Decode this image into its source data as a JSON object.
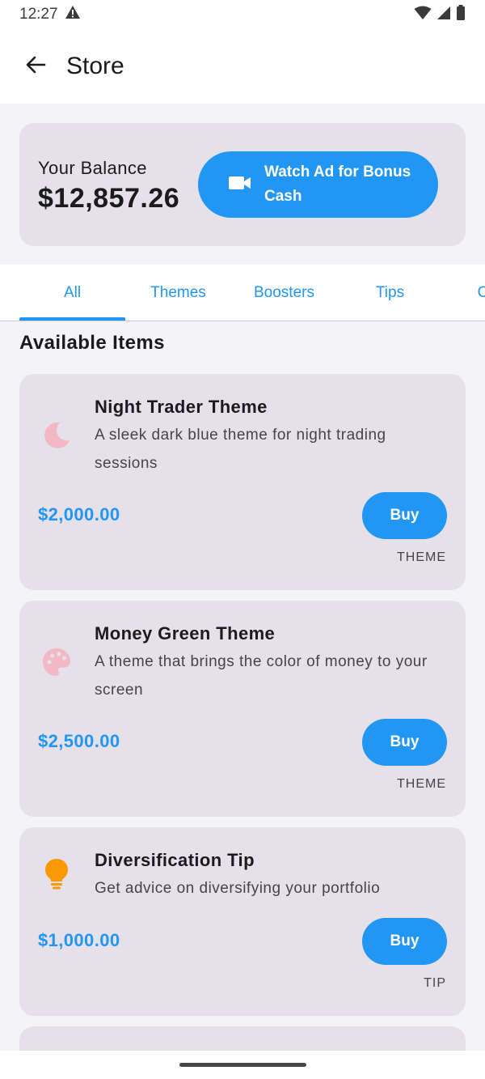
{
  "status_bar": {
    "time": "12:27"
  },
  "app_bar": {
    "title": "Store"
  },
  "balance": {
    "label": "Your Balance",
    "value": "$12,857.26",
    "watch_ad_label": "Watch Ad for Bonus Cash"
  },
  "tabs": [
    {
      "label": "All",
      "selected": true
    },
    {
      "label": "Themes",
      "selected": false
    },
    {
      "label": "Boosters",
      "selected": false
    },
    {
      "label": "Tips",
      "selected": false
    },
    {
      "label": "C",
      "selected": false
    }
  ],
  "section": {
    "title": "Available Items"
  },
  "items": [
    {
      "icon": "moon-icon",
      "icon_color": "#f2b8c6",
      "title": "Night Trader Theme",
      "description": "A sleek dark blue theme for night trading sessions",
      "price": "$2,000.00",
      "buy_label": "Buy",
      "type": "THEME"
    },
    {
      "icon": "palette-icon",
      "icon_color": "#f2b8c6",
      "title": "Money Green Theme",
      "description": "A theme that brings the color of money to your screen",
      "price": "$2,500.00",
      "buy_label": "Buy",
      "type": "THEME"
    },
    {
      "icon": "lightbulb-icon",
      "icon_color": "#fb9905",
      "title": "Diversification Tip",
      "description": "Get advice on diversifying your portfolio",
      "price": "$1,000.00",
      "buy_label": "Buy",
      "type": "TIP"
    }
  ],
  "colors": {
    "accent": "#2196f3",
    "card_background": "#e6e0e8"
  }
}
